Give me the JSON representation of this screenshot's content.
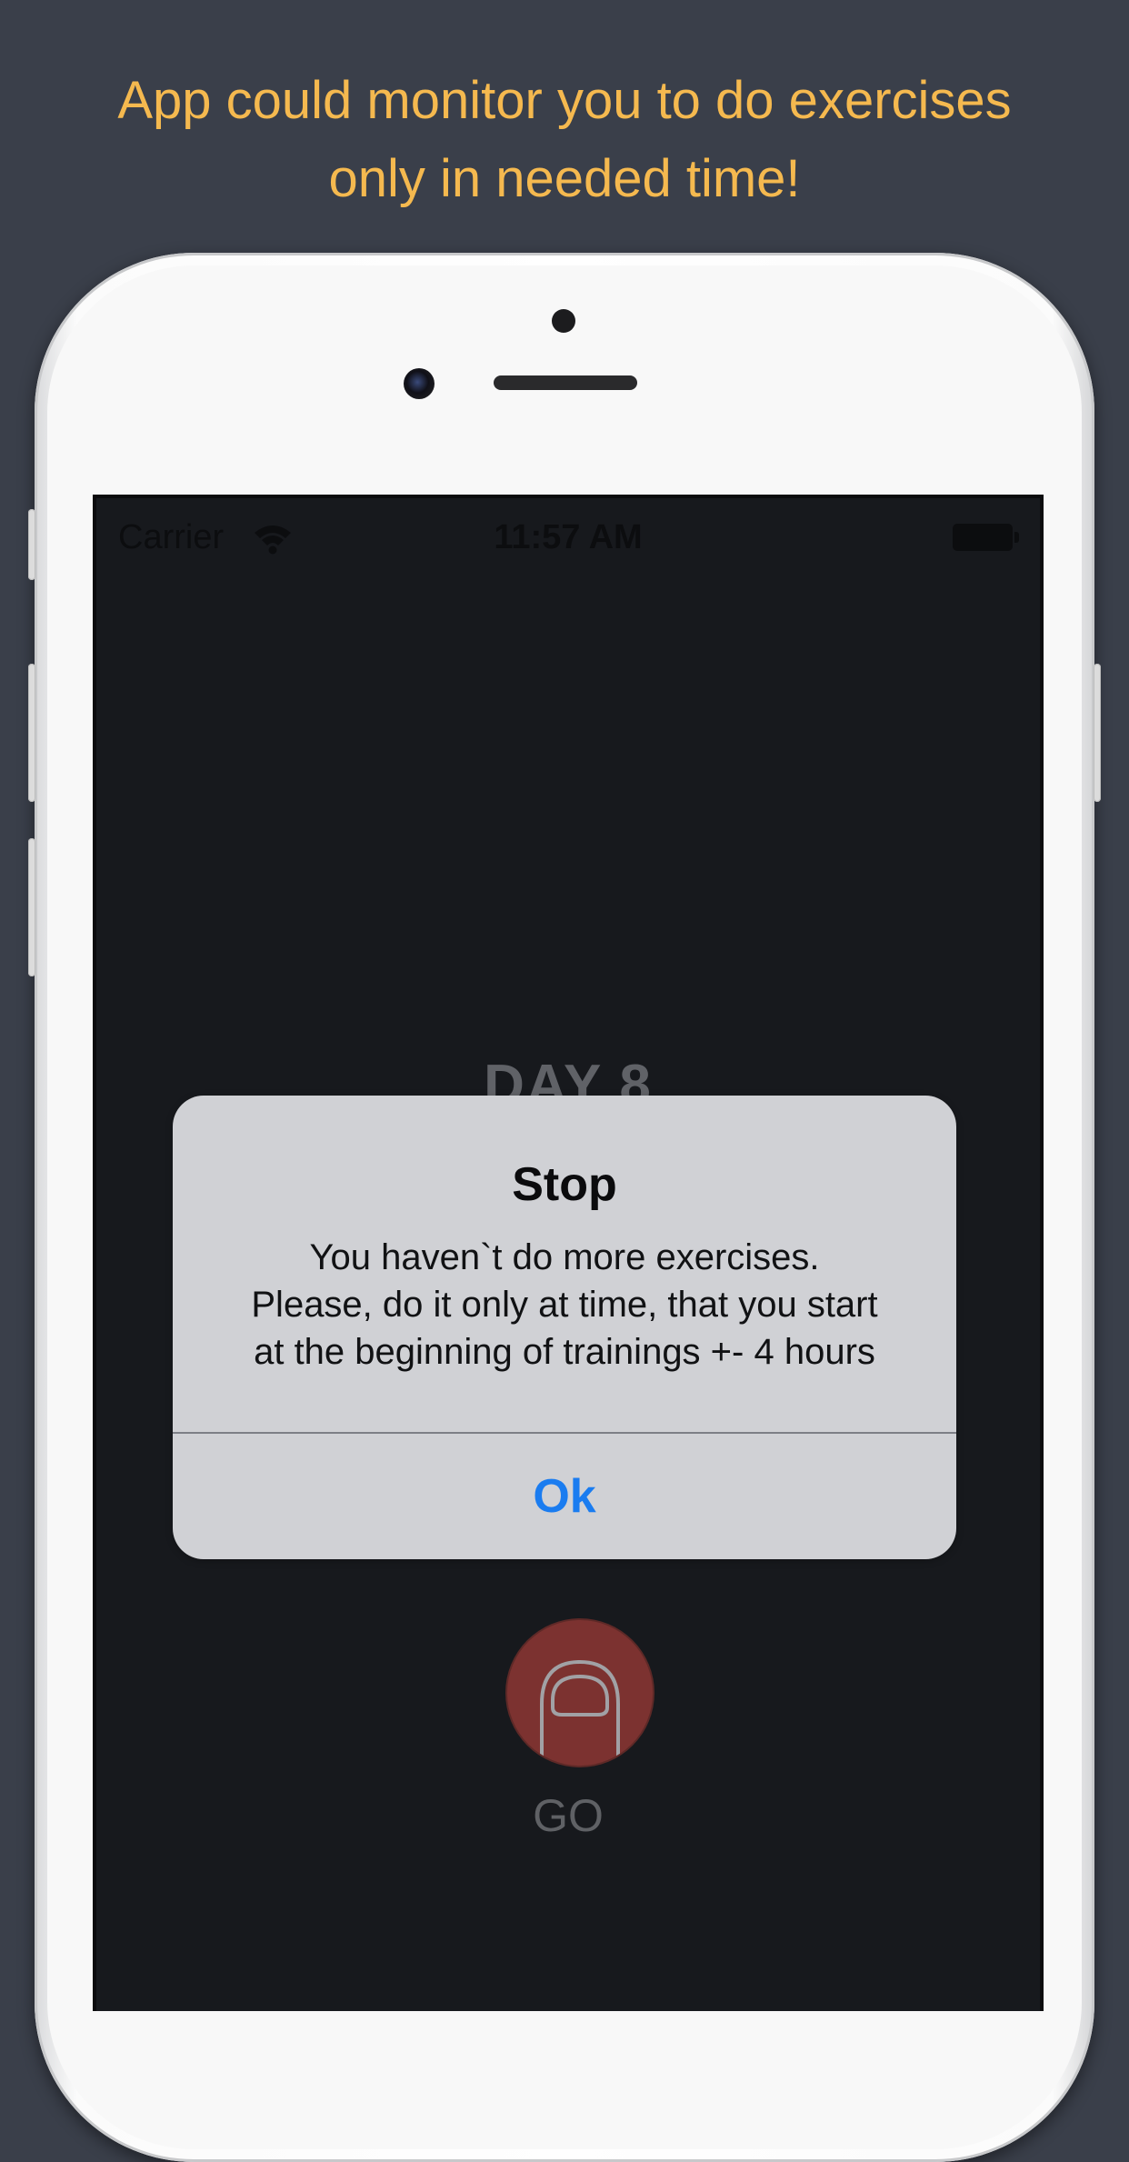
{
  "headline": {
    "line1": "App could monitor you to do exercises",
    "line2": "only in needed time!"
  },
  "statusbar": {
    "carrier": "Carrier",
    "time": "11:57 AM"
  },
  "screen": {
    "day_label": "DAY 8",
    "go_label": "GO"
  },
  "alert": {
    "title": "Stop",
    "message_lines": [
      "You haven`t do more exercises.",
      "Please, do it only at time, that you start",
      "at the beginning of trainings +- 4 hours"
    ],
    "ok_label": "Ok"
  },
  "colors": {
    "background": "#3a3f4a",
    "headline": "#f5b94f",
    "screen": "#1b1d22",
    "go_button": "#8e3a37",
    "alert_bg": "#d0d1d5",
    "alert_button": "#1a7cf0"
  },
  "icons": [
    "wifi-icon",
    "battery-icon",
    "finger-tap-icon"
  ]
}
